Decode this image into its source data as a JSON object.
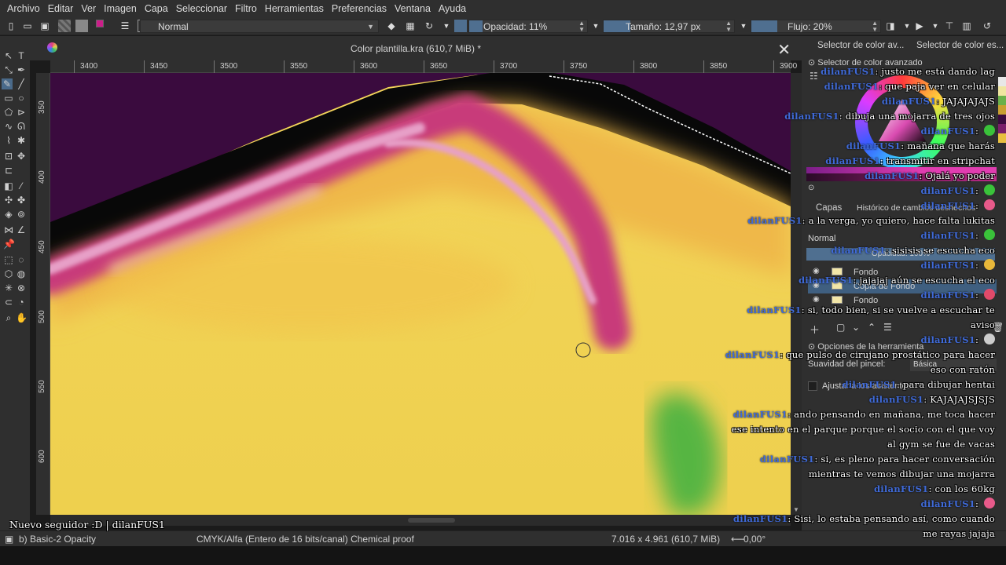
{
  "menubar": [
    "Archivo",
    "Editar",
    "Ver",
    "Imagen",
    "Capa",
    "Seleccionar",
    "Filtro",
    "Herramientas",
    "Preferencias",
    "Ventana",
    "Ayuda"
  ],
  "toolbar": {
    "blend_mode": "Normal",
    "opacity_label": "Opacidad: 11%",
    "opacity_fraction": 0.11,
    "size_label": "Tamaño: 12,97 px",
    "flow_label": "Flujo: 20%",
    "flow_fraction": 0.2,
    "fg_color": "#cc1e8a",
    "bg_color": "#ffffff"
  },
  "document": {
    "tab_title": "Color plantilla.kra (610,7 MiB) *"
  },
  "ruler": {
    "h_labels": [
      "3400",
      "3450",
      "3500",
      "3550",
      "3600",
      "3650",
      "3700",
      "3750",
      "3800",
      "3850",
      "3900"
    ],
    "v_labels": [
      "350",
      "400",
      "450",
      "500",
      "550",
      "600"
    ]
  },
  "dock": {
    "tab_1": "Selector de color av...",
    "tab_2": "Selector de color es...",
    "advanced_selector_title": "Selector de color avanzado",
    "layers_tab": "Capas",
    "history_tab": "Histórico de cambios deshechos",
    "blend": "Normal",
    "opacity": "Opacidad: 100%",
    "layers": [
      {
        "name": "Fondo"
      },
      {
        "name": "Copia de Fondo"
      },
      {
        "name": "Fondo"
      }
    ],
    "tool_options_title": "Opciones de la herramienta",
    "smoothing_label": "Suavidad del pincel:",
    "smoothing_value": "Básica",
    "snap_label": "Ajustar a los asistentes"
  },
  "status": {
    "brush": "b) Basic-2 Opacity",
    "colorspace": "CMYK/Alfa (Entero de 16 bits/canal)  Chemical proof",
    "dimensions": "7.016 x 4.961 (610,7 MiB)",
    "rotation": "0,00°"
  },
  "overlay": {
    "follower": "Nuevo seguidor :D | dilanFUS1",
    "chat": [
      {
        "user": "dilanFUS1",
        "text": "justo me está dando lag"
      },
      {
        "user": "dilanFUS1",
        "text": "que paja ver en celular"
      },
      {
        "user": "dilanFUS1",
        "text": "JAJAJAJAJS"
      },
      {
        "user": "dilanFUS1",
        "text": "dibuja una mojarra de tres ojos"
      },
      {
        "user": "dilanFUS1",
        "text": "",
        "emote": "#3ac23a"
      },
      {
        "user": "dilanFUS1",
        "text": "mañana que harás"
      },
      {
        "user": "dilanFUS1",
        "text": "transmitir en stripchat"
      },
      {
        "user": "dilanFUS1",
        "text": "Ojalá yo poder"
      },
      {
        "user": "dilanFUS1",
        "text": "",
        "emote": "#3ac23a"
      },
      {
        "user": "dilanFUS1",
        "text": "",
        "emote": "#e85a8a"
      },
      {
        "user": "dilanFUS1",
        "text": "a la verga, yo quiero, hace falta lukitas"
      },
      {
        "user": "dilanFUS1",
        "text": "",
        "emote": "#3ac23a"
      },
      {
        "user": "dilanFUS1",
        "text": "sisisis se escucha eco"
      },
      {
        "user": "dilanFUS1",
        "text": "",
        "emote": "#e8b83a"
      },
      {
        "user": "dilanFUS1",
        "text": "jajajaj aún se escucha el eco"
      },
      {
        "user": "dilanFUS1",
        "text": "",
        "emote": "#e04a6a"
      },
      {
        "user": "dilanFUS1",
        "text": "si, todo bien, si se vuelve a escuchar te aviso"
      },
      {
        "user": "dilanFUS1",
        "text": "",
        "emote": "#cccccc"
      },
      {
        "user": "dilanFUS1",
        "text": "que pulso de cirujano prostático para hacer eso con ratón"
      },
      {
        "user": "dilanFUS1",
        "text": "para dibujar hentai"
      },
      {
        "user": "dilanFUS1",
        "text": "KAJAJAJSJSJS"
      },
      {
        "user": "dilanFUS1",
        "text": "ando pensando en mañana, me toca hacer ese intento en el parque porque el socio con el que voy al gym se fue de vacas"
      },
      {
        "user": "dilanFUS1",
        "text": "si, es pleno para hacer conversación mientras te vemos dibujar una mojarra"
      },
      {
        "user": "dilanFUS1",
        "text": "con los 60kg"
      },
      {
        "user": "dilanFUS1",
        "text": "",
        "emote": "#e85a8a"
      },
      {
        "user": "dilanFUS1",
        "text": "Sisi, lo estaba pensando así, como cuando me rayas jajaja"
      }
    ]
  }
}
